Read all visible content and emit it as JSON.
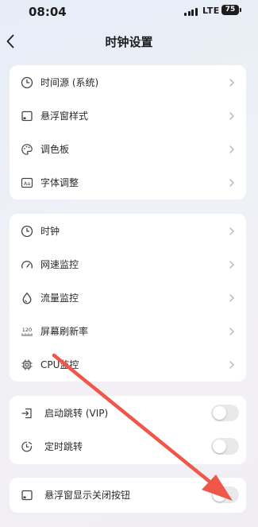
{
  "status_bar": {
    "time": "08:04",
    "network": "LTE",
    "battery": "75"
  },
  "header": {
    "title": "时钟设置"
  },
  "group1": [
    {
      "label": "时间源 (系统)",
      "icon": "clock-icon"
    },
    {
      "label": "悬浮窗样式",
      "icon": "window-icon"
    },
    {
      "label": "调色板",
      "icon": "palette-icon"
    },
    {
      "label": "字体调整",
      "icon": "font-icon"
    }
  ],
  "group2": [
    {
      "label": "时钟",
      "icon": "clock-icon"
    },
    {
      "label": "网速监控",
      "icon": "speedometer-icon"
    },
    {
      "label": "流量监控",
      "icon": "drop-icon"
    },
    {
      "label": "屏幕刷新率",
      "icon": "refresh-rate-icon",
      "icon_text": "120"
    },
    {
      "label": "CPU监控",
      "icon": "chip-icon"
    }
  ],
  "group3": [
    {
      "label": "启动跳转 (VIP)",
      "icon": "launch-icon",
      "toggle_on": false
    },
    {
      "label": "定时跳转",
      "icon": "timer-icon",
      "toggle_on": false
    }
  ],
  "group4": [
    {
      "label": "悬浮窗显示关闭按钮",
      "icon": "window-icon",
      "toggle_on": false
    }
  ],
  "colors": {
    "arrow": "#f0574a",
    "toggle_off": "#e9e9ec",
    "chevron": "#b5b5ba"
  }
}
